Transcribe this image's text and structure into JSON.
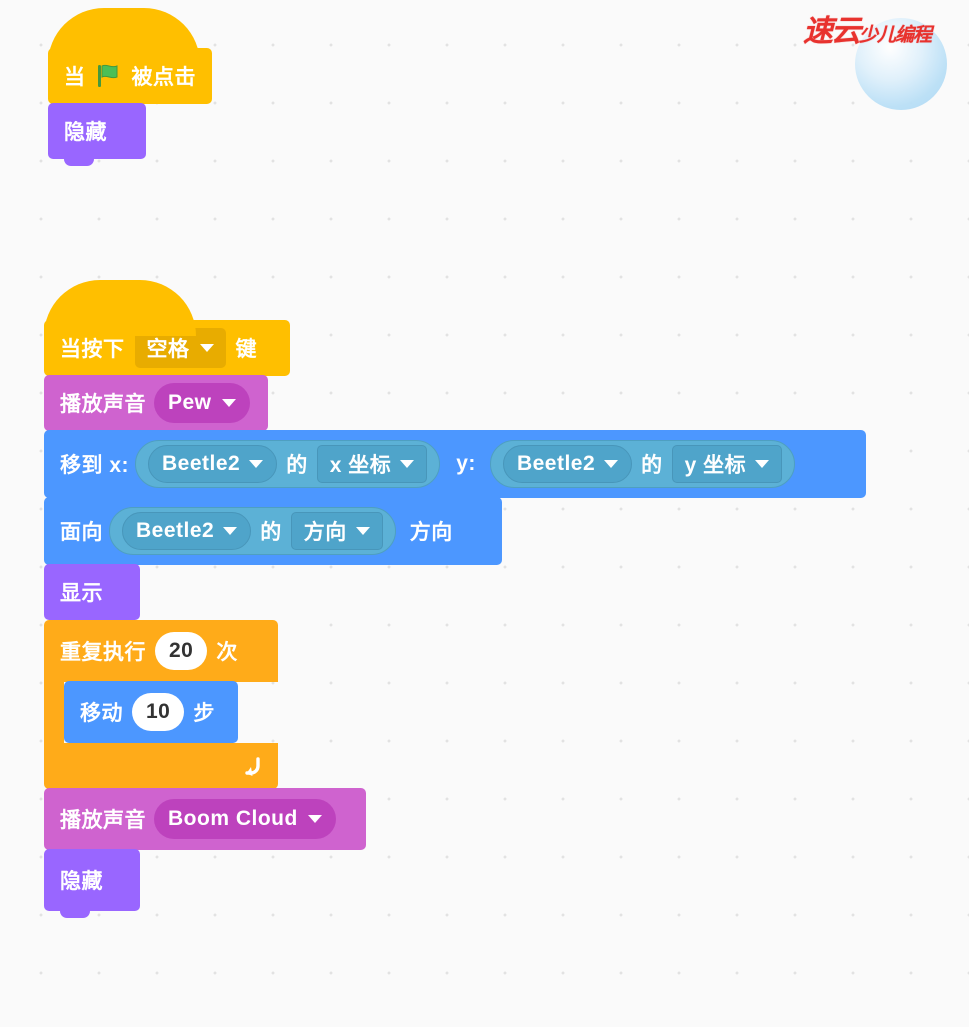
{
  "watermark": {
    "brand_main": "速云",
    "brand_sub": "少儿编程",
    "orb_color": "#b9dff6",
    "text_color": "#e8322e"
  },
  "canvas": {
    "background_color": "#fafafa",
    "dot_color": "#e2e2e2"
  },
  "palette": {
    "events": "#ffbf00",
    "looks": "#9966ff",
    "sound": "#cf63cf",
    "motion": "#4c97ff",
    "control": "#ffab19",
    "sensing": "#5cb1d6"
  },
  "scripts": [
    {
      "id": "script-1",
      "blocks": {
        "hat": {
          "prefix": "当",
          "icon": "green-flag-icon",
          "suffix": "被点击"
        },
        "hide": {
          "label": "隐藏"
        }
      }
    },
    {
      "id": "script-2",
      "blocks": {
        "hat": {
          "prefix": "当按下",
          "key_value": "空格",
          "suffix": "键"
        },
        "play_sound_1": {
          "label": "播放声音",
          "sound_value": "Pew"
        },
        "goto_xy": {
          "label_x": "移到 x:",
          "label_y": "y:",
          "x_reporter": {
            "sprite": "Beetle2",
            "of": "的",
            "property": "x 坐标"
          },
          "y_reporter": {
            "sprite": "Beetle2",
            "of": "的",
            "property": "y 坐标"
          }
        },
        "point_towards": {
          "label": "面向",
          "reporter": {
            "sprite": "Beetle2",
            "of": "的",
            "property": "方向"
          },
          "suffix": "方向"
        },
        "show": {
          "label": "显示"
        },
        "repeat": {
          "prefix": "重复执行",
          "times": "20",
          "suffix": "次",
          "loop_icon": "loop-arrow-icon",
          "inner": {
            "prefix": "移动",
            "steps": "10",
            "suffix": "步"
          }
        },
        "play_sound_2": {
          "label": "播放声音",
          "sound_value": "Boom Cloud"
        },
        "hide": {
          "label": "隐藏"
        }
      }
    }
  ]
}
